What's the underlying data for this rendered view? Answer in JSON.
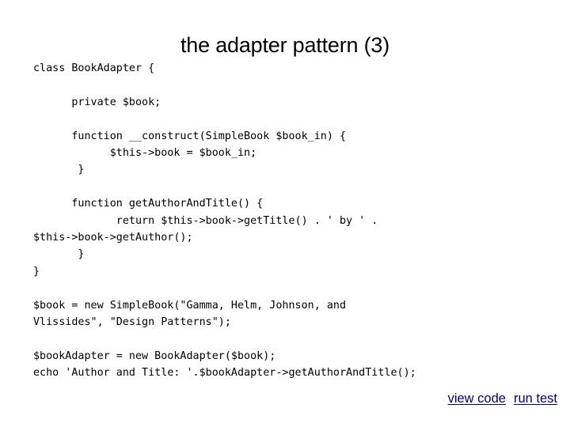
{
  "slide": {
    "title": "the adapter pattern (3)"
  },
  "code": {
    "language": "php",
    "lines": [
      "class BookAdapter {",
      "",
      "      private $book;",
      "",
      "      function __construct(SimpleBook $book_in) {",
      "            $this->book = $book_in;",
      "       }",
      "",
      "      function getAuthorAndTitle() {",
      "             return $this->book->getTitle() . ' by ' .",
      "$this->book->getAuthor();",
      "       }",
      "}",
      "",
      "$book = new SimpleBook(\"Gamma, Helm, Johnson, and",
      "Vlissides\", \"Design Patterns\");",
      "",
      "$bookAdapter = new BookAdapter($book);",
      "echo 'Author and Title: '.$bookAdapter->getAuthorAndTitle();"
    ]
  },
  "links": {
    "view_code": "view code",
    "run_test": "run test",
    "color": "#000080"
  }
}
